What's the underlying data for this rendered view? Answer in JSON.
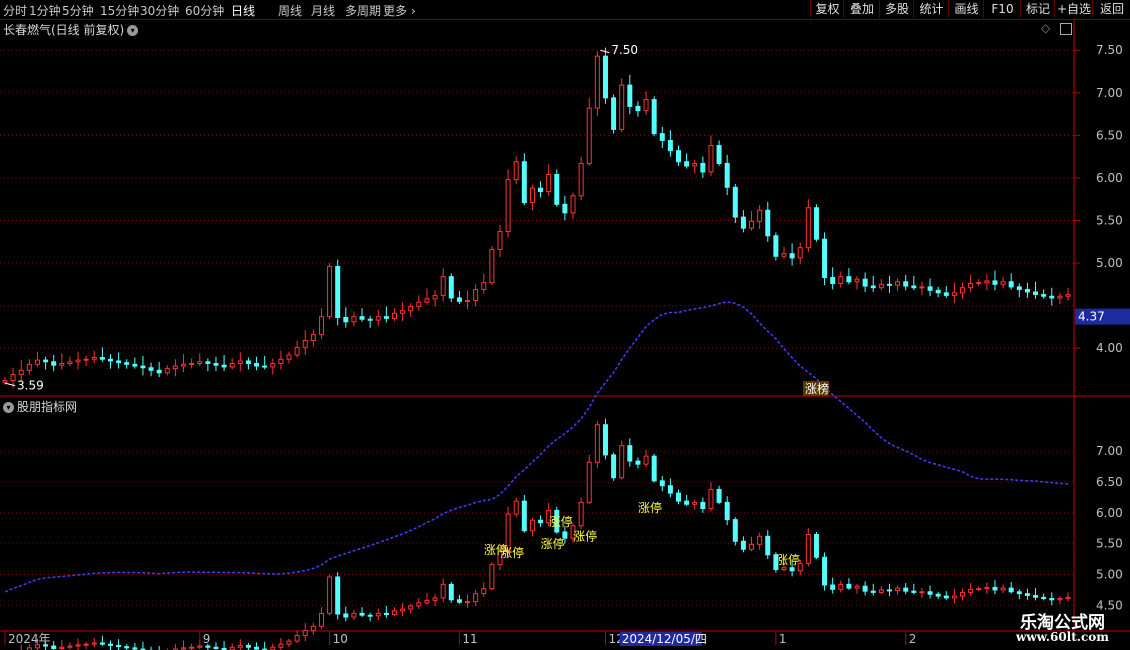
{
  "toolbar": {
    "periods": [
      "分时",
      "1分钟",
      "5分钟",
      "15分钟",
      "30分钟",
      "60分钟",
      "日线",
      "周线",
      "月线",
      "多周期",
      "更多"
    ],
    "active_period": "日线",
    "right_buttons": [
      "复权",
      "叠加",
      "多股",
      "统计",
      "画线",
      "F10",
      "标记",
      "+自选",
      "返回"
    ]
  },
  "main_panel": {
    "title": "长春燃气(日线 前复权)",
    "price_axis": [
      "7.50",
      "7.00",
      "6.50",
      "6.00",
      "5.50",
      "5.00",
      "4.00"
    ],
    "current_price": "4.37",
    "high_label": "7.50",
    "low_label": "3.59",
    "event_badge": "涨榜"
  },
  "indicator_panel": {
    "title": "股朋指标网",
    "axis": [
      "7.00",
      "6.50",
      "6.00",
      "5.50",
      "5.00",
      "4.50"
    ],
    "signal_text": "涨停",
    "signals": [
      {
        "day": 60,
        "y": 5.59
      },
      {
        "day": 62,
        "y": 5.54
      },
      {
        "day": 68,
        "y": 6.05
      },
      {
        "day": 67,
        "y": 5.69
      },
      {
        "day": 71,
        "y": 5.81
      },
      {
        "day": 79,
        "y": 6.27
      },
      {
        "day": 96,
        "y": 5.43
      }
    ]
  },
  "time_axis": {
    "labels": [
      {
        "text": "2024年",
        "day": 0
      },
      {
        "text": "9",
        "day": 24
      },
      {
        "text": "10",
        "day": 40
      },
      {
        "text": "11",
        "day": 56
      },
      {
        "text": "12",
        "day": 74
      },
      {
        "text": "1",
        "day": 95
      },
      {
        "text": "2",
        "day": 111
      }
    ],
    "cursor_date": "2024/12/05/四",
    "cursor_day": 76
  },
  "watermark": {
    "name": "乐淘公式网",
    "url": "www.60lt.com"
  },
  "colors": {
    "up": "#ff3232",
    "down": "#54ffff",
    "grid": "#800000",
    "axis": "#c00000",
    "ma": "#4040ff"
  },
  "chart_data": {
    "type": "candlestick",
    "closes": [
      3.62,
      3.69,
      3.74,
      3.81,
      3.86,
      3.84,
      3.8,
      3.82,
      3.84,
      3.86,
      3.87,
      3.89,
      3.87,
      3.85,
      3.83,
      3.81,
      3.79,
      3.77,
      3.74,
      3.71,
      3.76,
      3.79,
      3.81,
      3.82,
      3.84,
      3.82,
      3.8,
      3.78,
      3.82,
      3.85,
      3.82,
      3.79,
      3.78,
      3.82,
      3.87,
      3.92,
      4.01,
      4.09,
      4.16,
      4.37,
      4.96,
      4.36,
      4.31,
      4.37,
      4.34,
      4.33,
      4.37,
      4.35,
      4.41,
      4.44,
      4.49,
      4.54,
      4.58,
      4.62,
      4.84,
      4.59,
      4.55,
      4.56,
      4.69,
      4.77,
      5.16,
      5.37,
      5.98,
      6.19,
      5.71,
      5.88,
      5.84,
      6.04,
      5.69,
      5.59,
      5.79,
      6.17,
      6.82,
      7.43,
      6.94,
      6.57,
      7.09,
      6.84,
      6.79,
      6.92,
      6.52,
      6.44,
      6.32,
      6.19,
      6.14,
      6.17,
      6.07,
      6.38,
      6.17,
      5.89,
      5.54,
      5.41,
      5.49,
      5.62,
      5.32,
      5.08,
      5.11,
      5.06,
      5.18,
      5.65,
      5.28,
      4.83,
      4.76,
      4.84,
      4.78,
      4.81,
      4.73,
      4.71,
      4.75,
      4.74,
      4.78,
      4.73,
      4.71,
      4.72,
      4.68,
      4.65,
      4.62,
      4.65,
      4.71,
      4.76,
      4.77,
      4.79,
      4.75,
      4.78,
      4.72,
      4.69,
      4.66,
      4.63,
      4.61,
      4.59,
      4.61,
      4.63
    ],
    "ylim": [
      3.45,
      7.62
    ]
  }
}
